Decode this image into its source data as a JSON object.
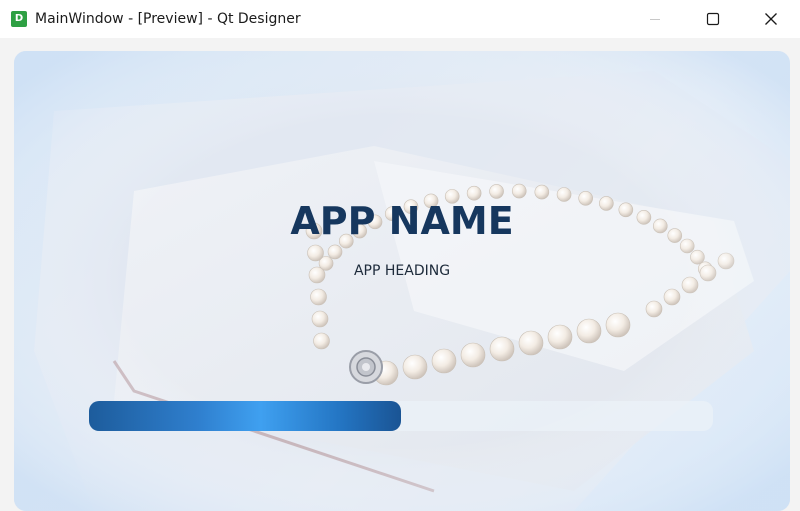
{
  "window": {
    "title": "MainWindow - [Preview] - Qt Designer",
    "app_icon_letter": "D",
    "app_icon_color": "#2ea043",
    "caption_buttons": [
      "minimize-icon",
      "maximize-icon",
      "close-icon"
    ]
  },
  "splash": {
    "app_name": "APP NAME",
    "app_heading": "APP HEADING",
    "background_image": "pearl necklace in white jewelry box",
    "progress": 0.5,
    "colors": {
      "app_name": "#16375e",
      "progress_fill": "#3fa0f0",
      "progress_track": "#ebf1f8"
    }
  }
}
